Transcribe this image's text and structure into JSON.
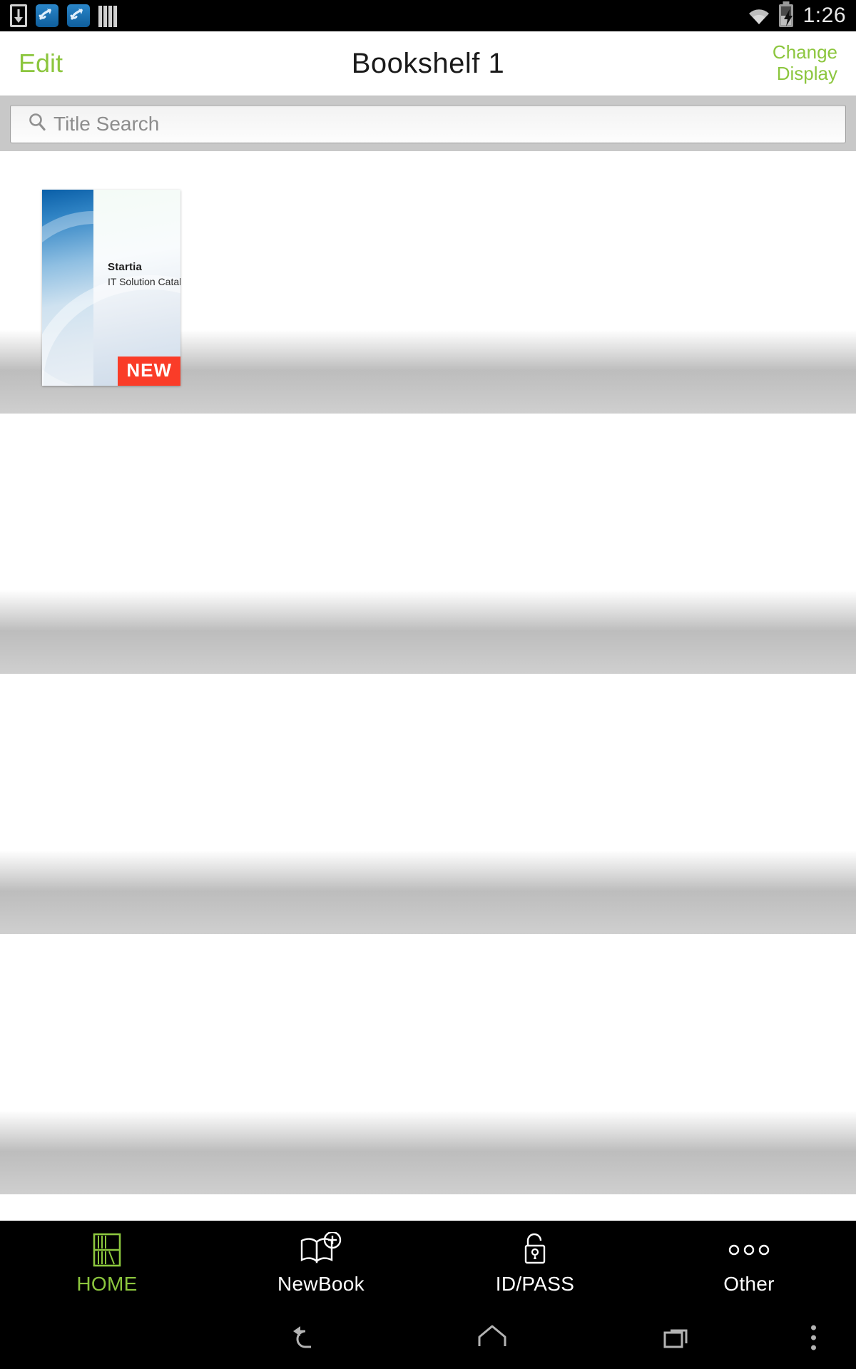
{
  "status_bar": {
    "time": "1:26",
    "left_icons": [
      "download-icon",
      "sync-blue-icon",
      "sync-blue-icon-2",
      "barcode-icon"
    ],
    "right_icons": [
      "wifi-icon",
      "battery-charging-icon"
    ]
  },
  "header": {
    "edit_label": "Edit",
    "title": "Bookshelf 1",
    "change_display_line1": "Change",
    "change_display_line2": "Display"
  },
  "search": {
    "placeholder": "Title Search",
    "value": "",
    "icon": "search-icon"
  },
  "shelves": {
    "count": 4,
    "books": [
      {
        "brand": "Startia",
        "subtitle": "IT Solution Catalog",
        "badge": "NEW",
        "badge_color": "#FA3C28",
        "shelf_index": 0
      }
    ]
  },
  "tabbar": {
    "items": [
      {
        "label": "HOME",
        "icon": "bookshelf-icon",
        "active": true
      },
      {
        "label": "NewBook",
        "icon": "new-book-icon",
        "active": false
      },
      {
        "label": "ID/PASS",
        "icon": "open-padlock-icon",
        "active": false
      },
      {
        "label": "Other",
        "icon": "three-dots-icon",
        "active": false
      }
    ]
  },
  "system_nav": {
    "buttons": [
      "back-icon",
      "home-icon",
      "recents-icon",
      "overflow-menu-icon"
    ]
  },
  "colors": {
    "accent_green": "#8CC63E",
    "badge_red": "#FA3C28",
    "statusbar_black": "#000000",
    "search_strip": "#C8C8C8"
  }
}
